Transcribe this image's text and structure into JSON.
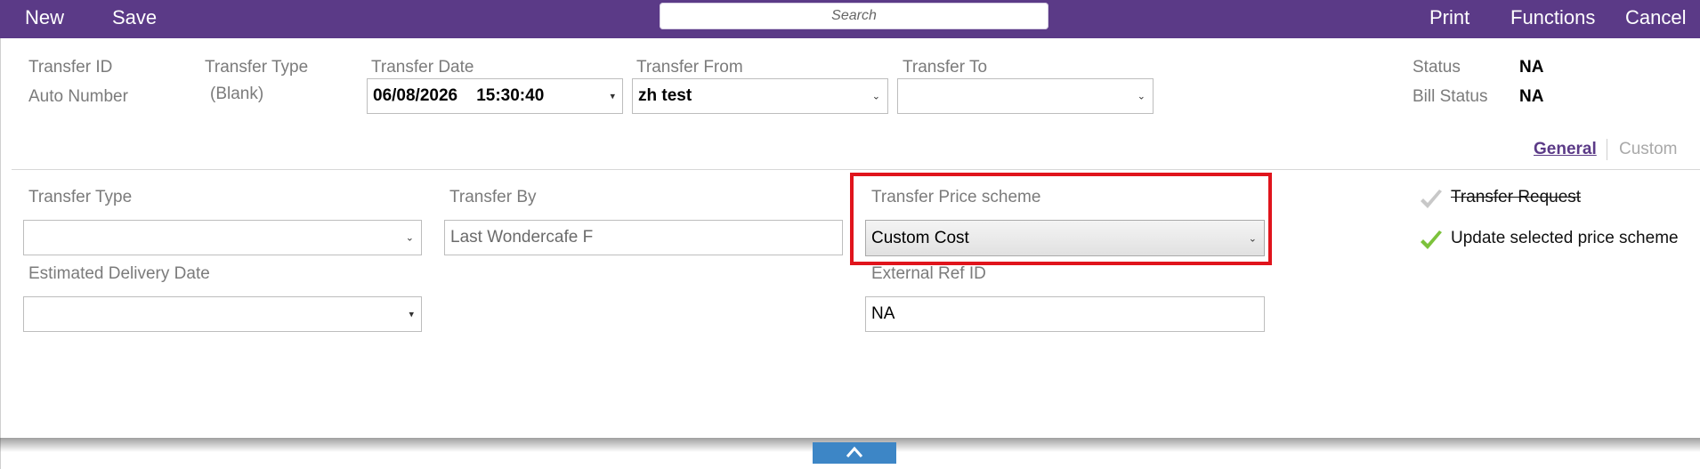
{
  "toolbar": {
    "new_label": "New",
    "save_label": "Save",
    "search_placeholder": "Search",
    "print_label": "Print",
    "functions_label": "Functions",
    "cancel_label": "Cancel",
    "background_color": "#5b3a87"
  },
  "header": {
    "transfer_id_label": "Transfer ID",
    "transfer_id_value": "Auto Number",
    "transfer_type_label": "Transfer Type",
    "transfer_type_value": "(Blank)",
    "transfer_date_label": "Transfer Date",
    "transfer_date_value": "06/08/2026    15:30:40",
    "transfer_from_label": "Transfer From",
    "transfer_from_value": "zh test",
    "transfer_to_label": "Transfer To",
    "transfer_to_value": "",
    "status_label": "Status",
    "status_value": "NA",
    "bill_status_label": "Bill Status",
    "bill_status_value": "NA"
  },
  "tabs": [
    {
      "label": "General",
      "active": true
    },
    {
      "label": "Custom",
      "active": false
    }
  ],
  "form": {
    "transfer_type_label": "Transfer Type",
    "transfer_type_value": "",
    "transfer_by_label": "Transfer By",
    "transfer_by_value": "Last Wondercafe F",
    "price_scheme_label": "Transfer Price scheme",
    "price_scheme_value": "Custom Cost",
    "estimated_delivery_label": "Estimated Delivery Date",
    "estimated_delivery_value": "",
    "external_ref_label": "External Ref ID",
    "external_ref_value": "NA"
  },
  "options": {
    "transfer_request_label": "Transfer Request",
    "transfer_request_checked": false,
    "update_price_scheme_label": "Update selected price scheme",
    "update_price_scheme_checked": true
  },
  "colors": {
    "accent": "#5b3a87",
    "highlight_border": "#e0141c",
    "collapse_button": "#3d86c6",
    "check_active": "#7cc23b",
    "check_inactive": "#c8c8c8"
  },
  "icons": {
    "collapse": "chevron-up-icon",
    "dropdown": "chevron-down-icon",
    "checkmark": "check-icon"
  }
}
